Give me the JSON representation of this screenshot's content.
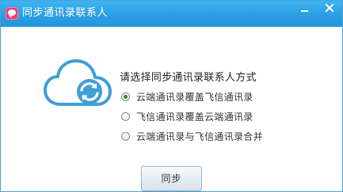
{
  "window": {
    "title": "同步通讯录联系人",
    "icon": "fetion-app-icon"
  },
  "controls": {
    "minimize_icon": "minimize-icon",
    "close_icon": "close-icon"
  },
  "illustration": {
    "icon": "cloud-sync-icon",
    "color": "#3f9fd6"
  },
  "prompt": "请选择同步通讯录联系人方式",
  "options": [
    {
      "label": "云端通讯录覆盖飞信通讯录",
      "selected": true
    },
    {
      "label": "飞信通讯录覆盖云端通讯录",
      "selected": false
    },
    {
      "label": "云端通讯录与飞信通讯录合并",
      "selected": false
    }
  ],
  "sync_button": "同步",
  "colors": {
    "titlebar": "#2a9fe3",
    "app_icon": "#ec3f7a",
    "radio_selected": "#2e8b2e"
  }
}
